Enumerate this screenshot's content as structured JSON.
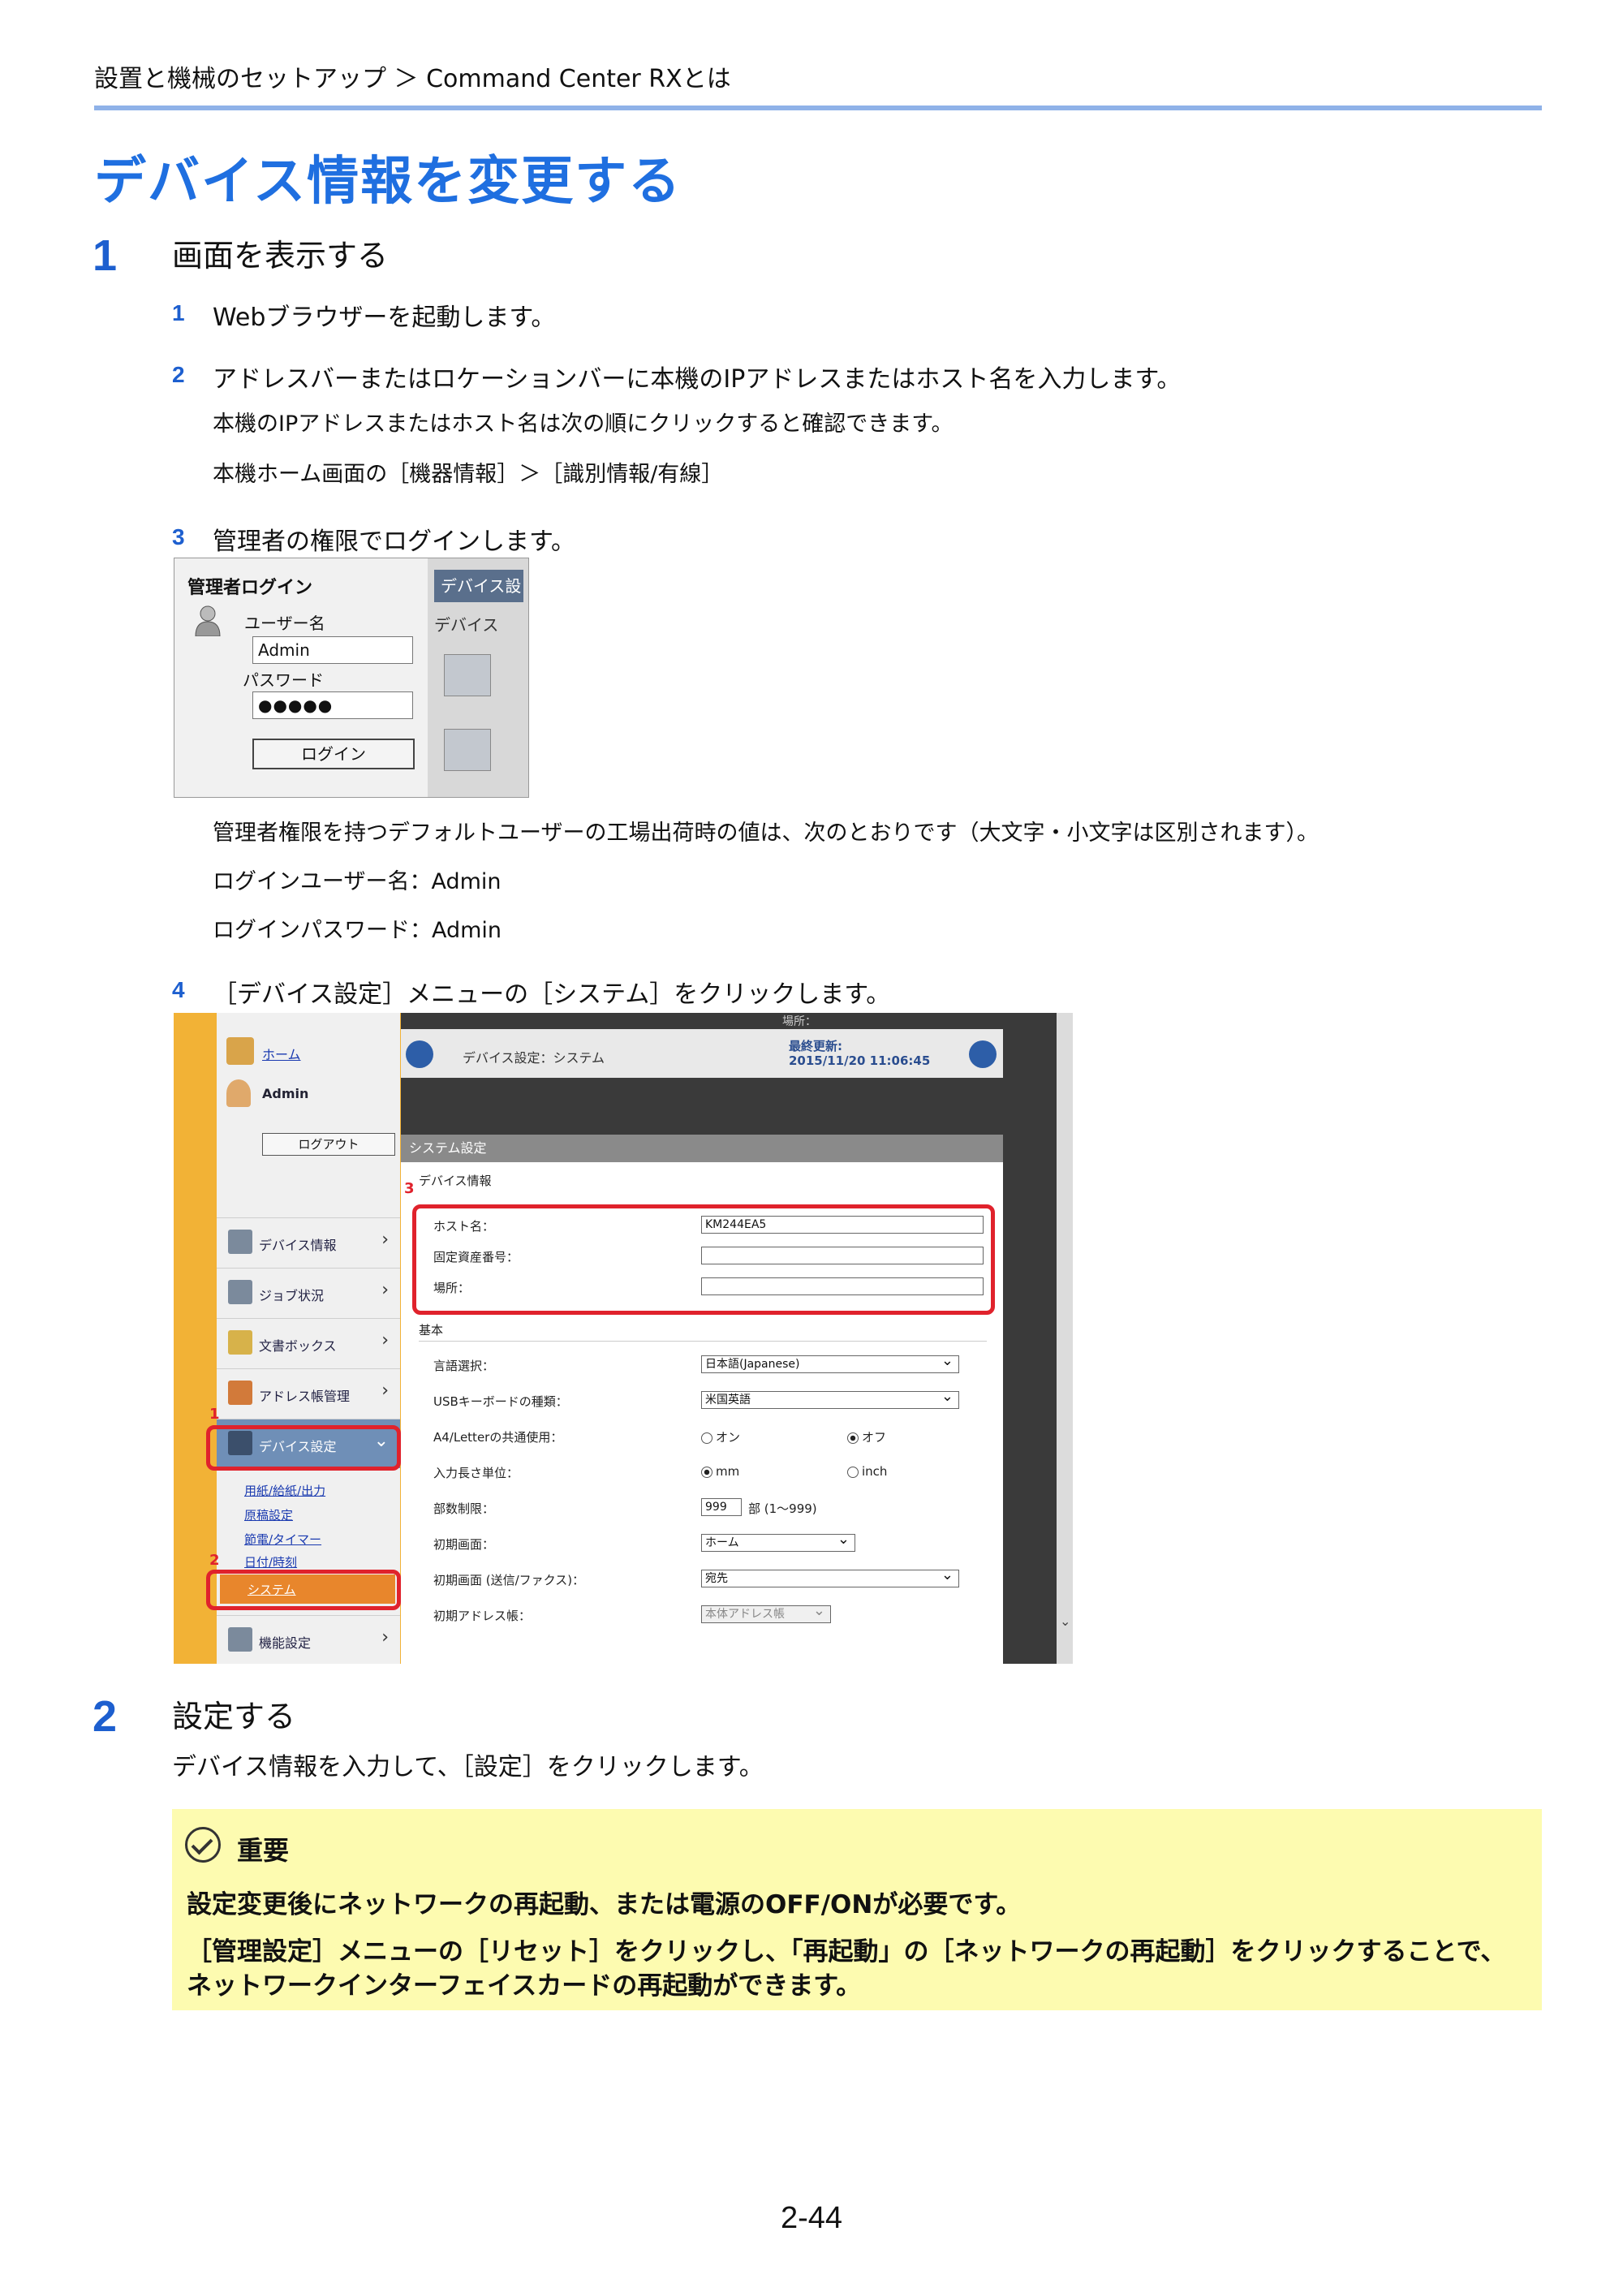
{
  "header": {
    "breadcrumb": "設置と機械のセットアップ ＞ Command Center RXとは",
    "title": "デバイス情報を変更する"
  },
  "step1": {
    "number": "1",
    "title": "画面を表示する",
    "items": [
      {
        "num": "1",
        "text": "Webブラウザーを起動します。"
      },
      {
        "num": "2",
        "text": "アドレスバーまたはロケーションバーに本機のIPアドレスまたはホスト名を入力します。"
      },
      {
        "num": "3",
        "text": "管理者の権限でログインします。"
      },
      {
        "num": "4",
        "text": "［デバイス設定］メニューの［システム］をクリックします。"
      }
    ],
    "note2_line1": "本機のIPアドレスまたはホスト名は次の順にクリックすると確認できます。",
    "note2_line2": "本機ホーム画面の［機器情報］＞［識別情報/有線］",
    "note3_line1": "管理者権限を持つデフォルトユーザーの工場出荷時の値は、次のとおりです（大文字・小文字は区別されます）。",
    "note3_line2": "ログインユーザー名：Admin",
    "note3_line3": "ログインパスワード：Admin"
  },
  "login_shot": {
    "title": "管理者ログイン",
    "user_label": "ユーザー名",
    "user_value": "Admin",
    "pass_label": "パスワード",
    "pass_value": "●●●●●",
    "login_button": "ログイン",
    "tab1": "デバイス設",
    "tab2": "デバイス"
  },
  "system_shot": {
    "top_cut": "場所：",
    "home": "ホーム",
    "user": "Admin",
    "logout": "ログアウト",
    "nav": [
      "デバイス情報",
      "ジョブ状況",
      "文書ボックス",
      "アドレス帳管理",
      "デバイス設定",
      "機能設定"
    ],
    "submenu": [
      "用紙/給紙/出力",
      "原稿設定",
      "節電/タイマー",
      "日付/時刻"
    ],
    "system_item": "システム",
    "header_title": "デバイス設定：システム",
    "last_update_label": "最終更新:",
    "last_update_value": "2015/11/20 11:06:45",
    "panel_title": "システム設定",
    "section_device": "デバイス情報",
    "host_label": "ホスト名：",
    "host_value": "KM244EA5",
    "asset_label": "固定資産番号：",
    "location_label": "場所：",
    "section_basic": "基本",
    "rows": [
      {
        "label": "言語選択：",
        "value": "日本語(Japanese)"
      },
      {
        "label": "USBキーボードの種類：",
        "value": "米国英語"
      },
      {
        "label": "A4/Letterの共通使用：",
        "opt1": "オン",
        "opt2": "オフ"
      },
      {
        "label": "入力長さ単位：",
        "opt1": "mm",
        "opt2": "inch"
      },
      {
        "label": "部数制限：",
        "value": "999",
        "suffix": "部 (1〜999)"
      },
      {
        "label": "初期画面：",
        "value": "ホーム"
      },
      {
        "label": "初期画面 (送信/ファクス)：",
        "value": "宛先"
      },
      {
        "label": "初期アドレス帳：",
        "value": "本体アドレス帳"
      }
    ],
    "markers": [
      "1",
      "2",
      "3"
    ]
  },
  "step2": {
    "number": "2",
    "title": "設定する",
    "text": "デバイス情報を入力して、［設定］をクリックします。"
  },
  "important": {
    "title": "重要",
    "line1": "設定変更後にネットワークの再起動、または電源のOFF/ONが必要です。",
    "line2": "［管理設定］メニューの［リセット］をクリックし、「再起動」の［ネットワークの再起動］をクリックすることで、",
    "line3": "ネットワークインターフェイスカードの再起動ができます。"
  },
  "footer": {
    "page_number": "2-44"
  }
}
